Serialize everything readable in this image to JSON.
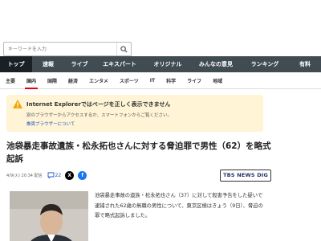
{
  "search": {
    "placeholder": "キーワードを入力"
  },
  "topnav": [
    {
      "label": "トップ",
      "active": true
    },
    {
      "label": "速報"
    },
    {
      "label": "ライブ"
    },
    {
      "label": "エキスパート"
    },
    {
      "label": "オリジナル"
    },
    {
      "label": "みんなの意見"
    },
    {
      "label": "ランキング"
    },
    {
      "label": "有料"
    }
  ],
  "subnav": [
    {
      "label": "主要"
    },
    {
      "label": "国内",
      "active": true
    },
    {
      "label": "国際"
    },
    {
      "label": "経済"
    },
    {
      "label": "エンタメ"
    },
    {
      "label": "スポーツ"
    },
    {
      "label": "IT"
    },
    {
      "label": "科学"
    },
    {
      "label": "ライフ"
    },
    {
      "label": "地域"
    }
  ],
  "ie_notice": {
    "title": "Internet Explorerではページを正しく表示できません",
    "desc": "別のブラウザーからアクセスするか、スマートフォンからご覧ください。",
    "link": "推奨ブラウザーについて"
  },
  "article": {
    "title": "池袋暴走事故遺族・松永拓也さんに対する脅迫罪で男性（62）を略式起訴",
    "date": "4/9(火) 20:34 配信",
    "comment_count": "22",
    "source_logo": "TBS NEWS DIG",
    "body": "池袋暴走事故の遺族・松永拓也さん（37）に対して殺害予告をした疑いで逮捕された62歳の無職の男性について、東京区検はきょう（9日）、脅迫の罪で略式起訴しました。"
  },
  "colors": {
    "nav_bg": "#404b52",
    "accent": "#e60012",
    "notice_bg": "#fff4d6"
  }
}
